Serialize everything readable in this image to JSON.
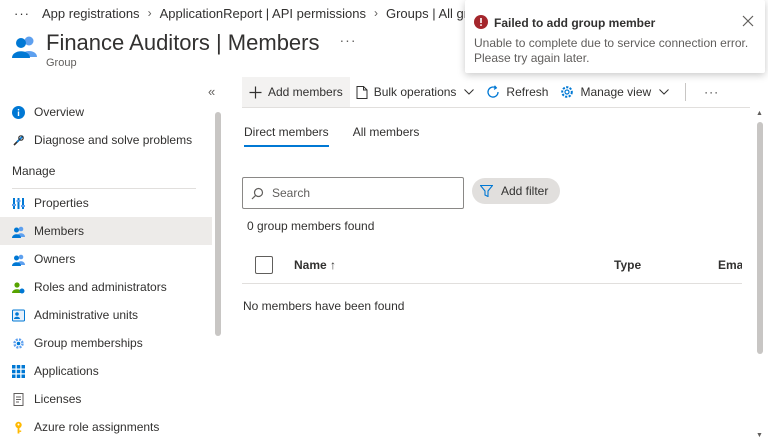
{
  "breadcrumb": {
    "more": "···",
    "items": [
      "App registrations",
      "ApplicationReport | API permissions",
      "Groups | All grou"
    ]
  },
  "header": {
    "title": "Finance Auditors | Members",
    "more": "···",
    "subtitle": "Group"
  },
  "sidebar": {
    "collapse": "«",
    "items": [
      {
        "label": "Overview",
        "icon": "info-icon"
      },
      {
        "label": "Diagnose and solve problems",
        "icon": "wrench-icon"
      }
    ],
    "section": "Manage",
    "manage_items": [
      {
        "label": "Properties",
        "icon": "properties-icon"
      },
      {
        "label": "Members",
        "icon": "members-icon",
        "active": true
      },
      {
        "label": "Owners",
        "icon": "owners-icon"
      },
      {
        "label": "Roles and administrators",
        "icon": "roles-icon"
      },
      {
        "label": "Administrative units",
        "icon": "admin-units-icon"
      },
      {
        "label": "Group memberships",
        "icon": "gear-icon"
      },
      {
        "label": "Applications",
        "icon": "apps-grid-icon"
      },
      {
        "label": "Licenses",
        "icon": "license-icon"
      },
      {
        "label": "Azure role assignments",
        "icon": "key-icon"
      }
    ]
  },
  "toolbar": {
    "add_members": "Add members",
    "bulk_operations": "Bulk operations",
    "refresh": "Refresh",
    "manage_view": "Manage view",
    "more": "···"
  },
  "tabs": [
    "Direct members",
    "All members"
  ],
  "search": {
    "placeholder": "Search"
  },
  "filter": {
    "label": "Add filter"
  },
  "count_text": "0 group members found",
  "table": {
    "columns": [
      "Name ↑",
      "Type",
      "Email"
    ]
  },
  "empty_text": "No members have been found",
  "toast": {
    "title": "Failed to add group member",
    "message": "Unable to complete due to service connection error. Please try again later."
  },
  "colors": {
    "accent": "#0078d4",
    "error": "#a4262c",
    "icon_blue": "#0078d4"
  }
}
